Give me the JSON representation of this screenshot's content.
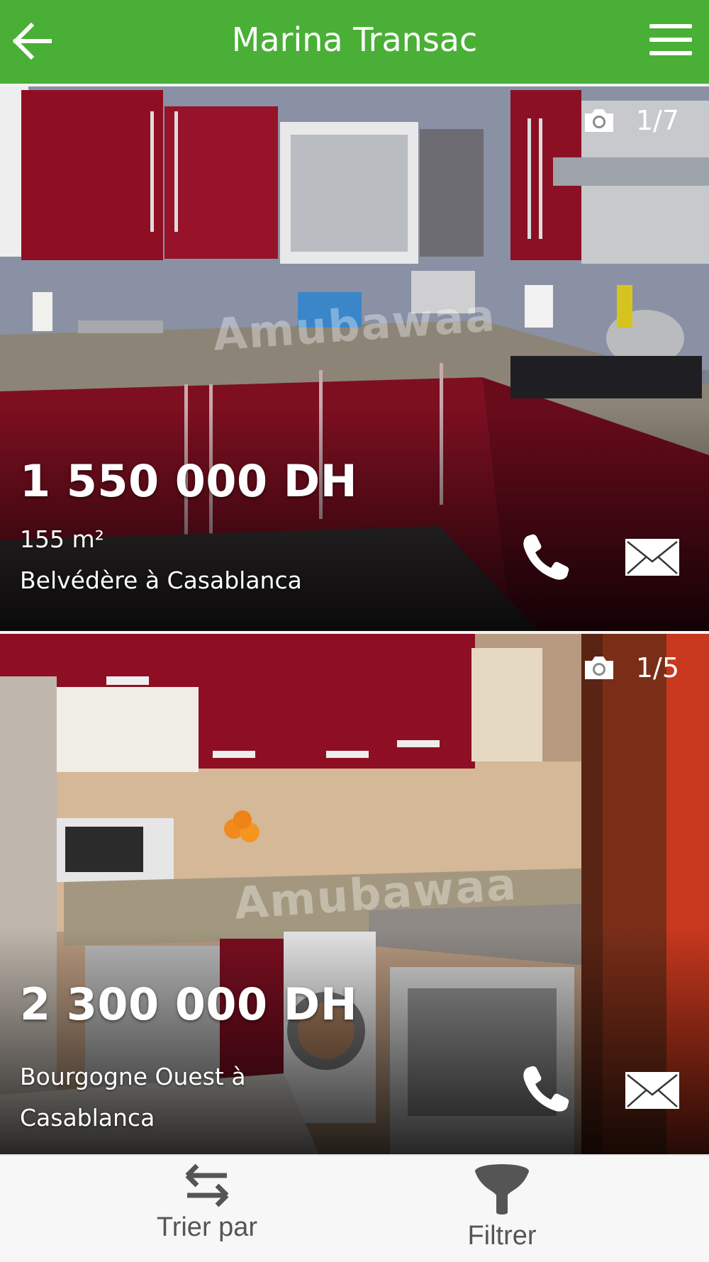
{
  "header": {
    "title": "Marina Transac",
    "back_icon": "arrow-left-icon",
    "menu_icon": "hamburger-menu-icon",
    "color": "#4aaf36"
  },
  "listings": [
    {
      "counter": "1/7",
      "price": "1 550 000 DH",
      "area": "155 m²",
      "location": "Belvédère à Casablanca",
      "watermark": "Amubawaa"
    },
    {
      "counter": "1/5",
      "price": "2 300 000 DH",
      "area": "",
      "location_line1": "Bourgogne Ouest à",
      "location_line2": "Casablanca",
      "watermark": "Amubawaa"
    }
  ],
  "bottom_bar": {
    "sort_label": "Trier par",
    "filter_label": "Filtrer"
  }
}
